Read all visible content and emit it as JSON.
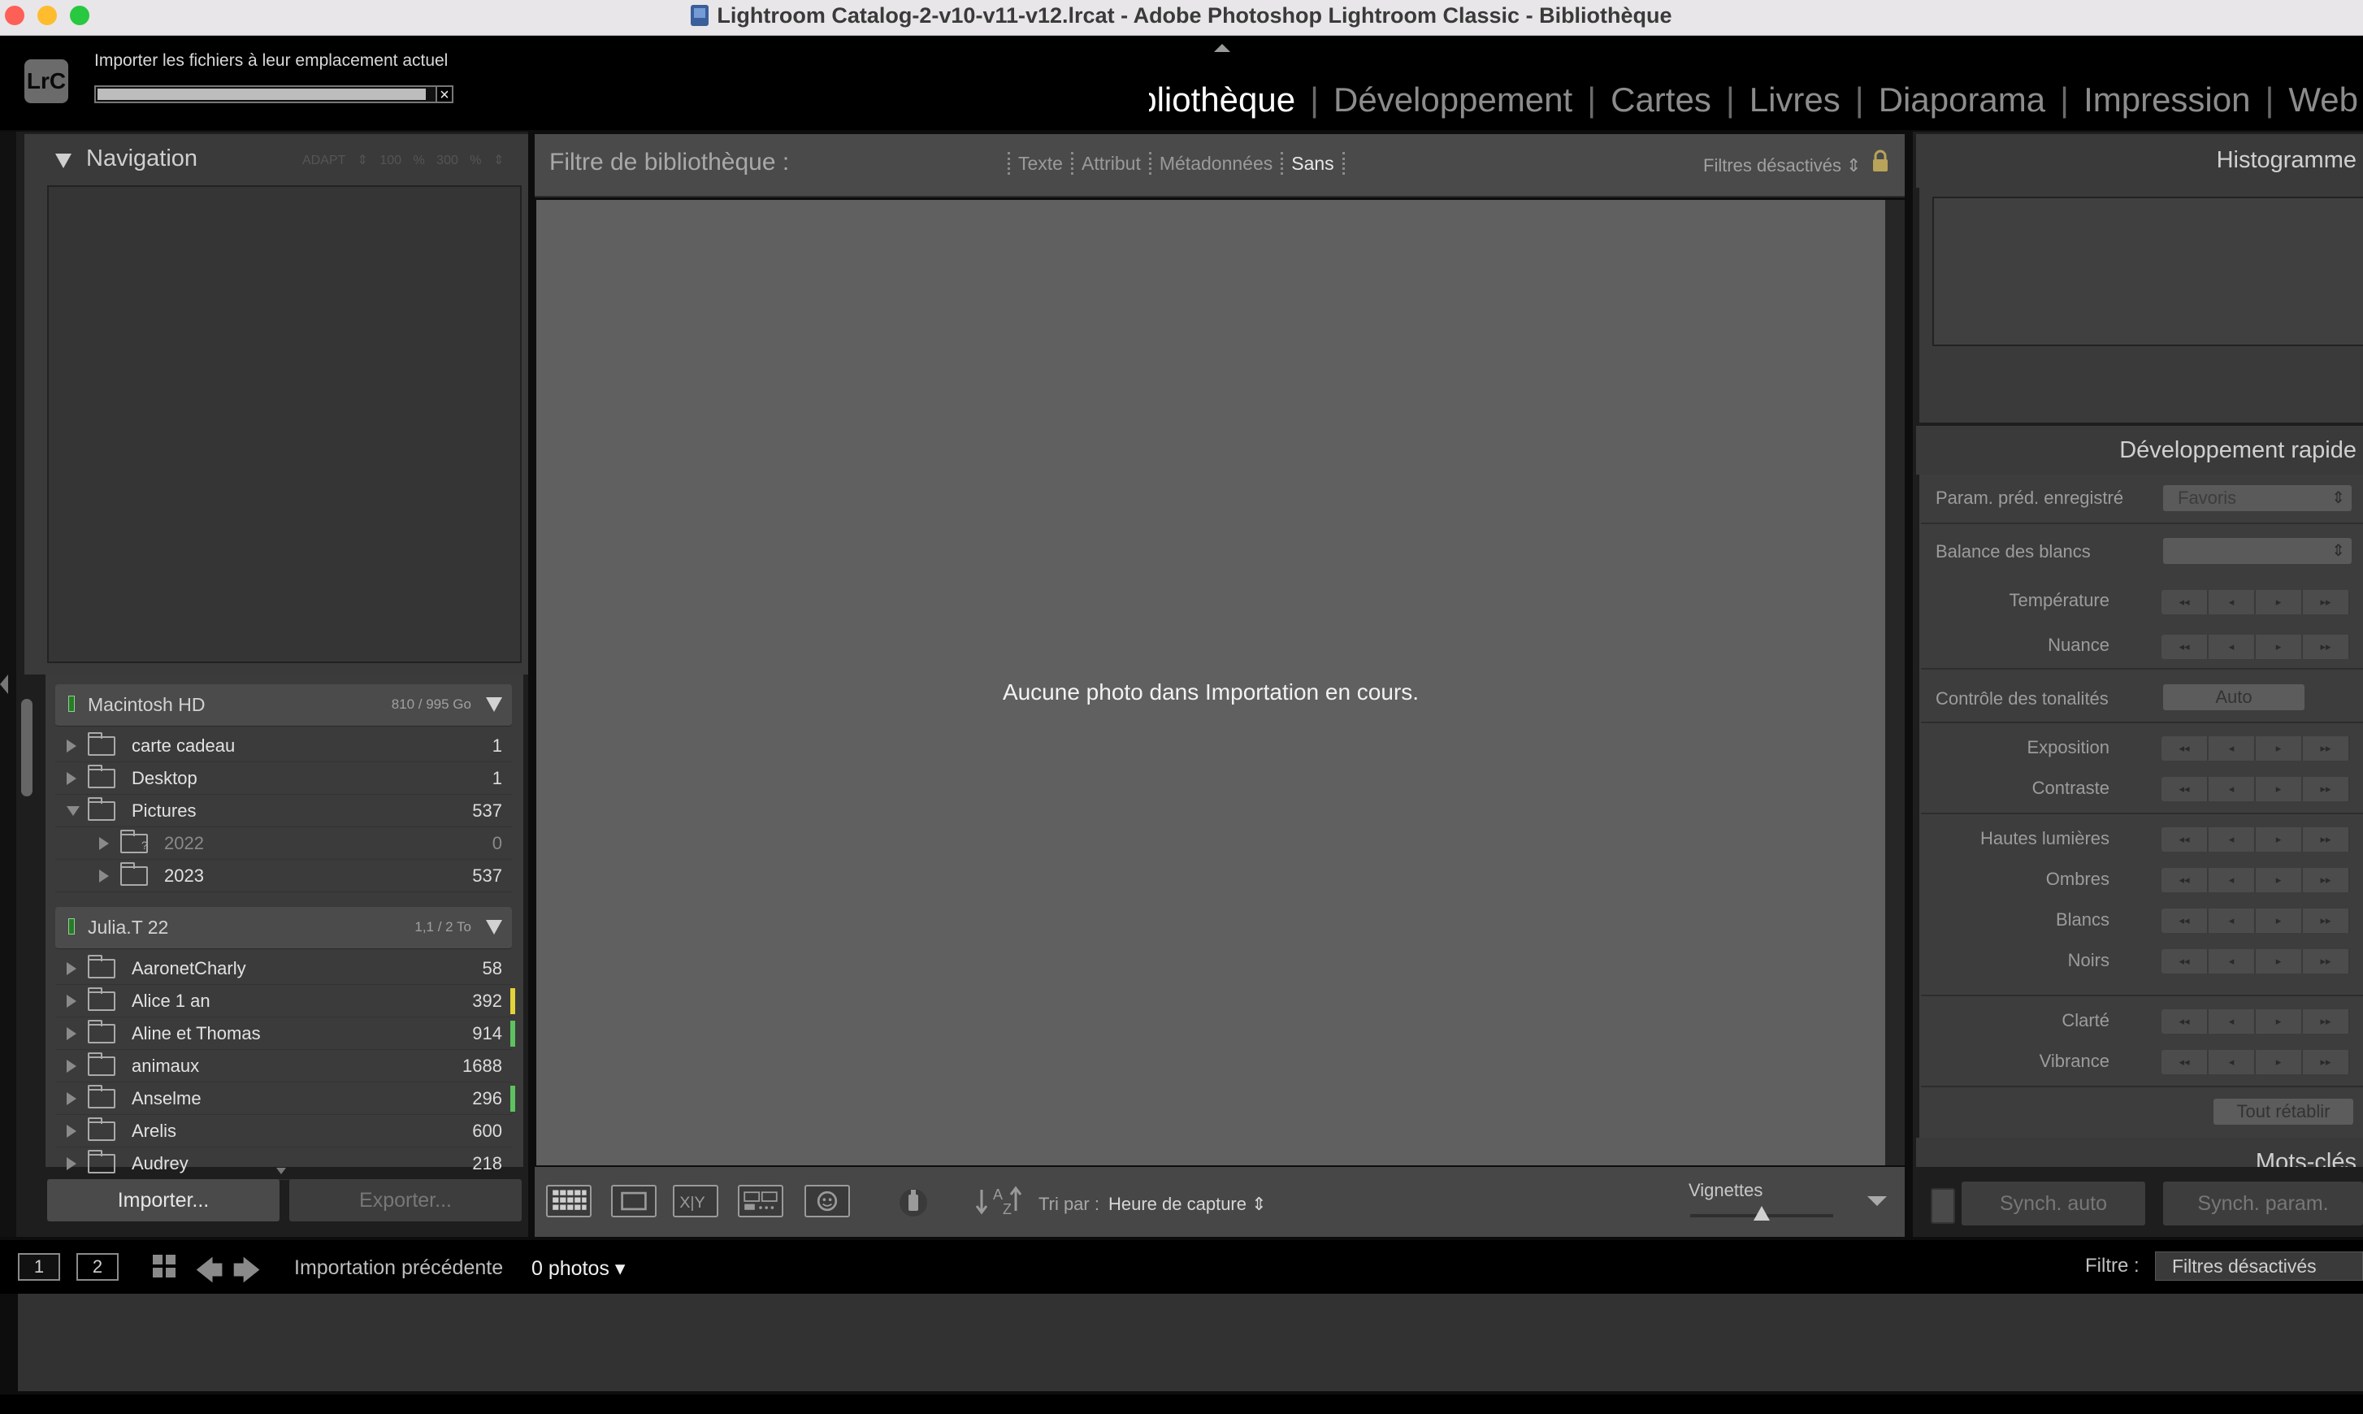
{
  "window": {
    "title": "Lightroom Catalog-2-v10-v11-v12.lrcat - Adobe Photoshop Lightroom Classic - Bibliothèque"
  },
  "identity": {
    "logo": "LrC",
    "import_status": "Importer les fichiers à leur emplacement actuel",
    "import_progress_percent": 97,
    "modules": [
      "ibliothèque",
      "Développement",
      "Cartes",
      "Livres",
      "Diaporama",
      "Impression",
      "Web"
    ],
    "active_module": "ibliothèque"
  },
  "navigator": {
    "title": "Navigation",
    "options": "ADAPT ⇕   100 %   300 % ⇕"
  },
  "folders": {
    "volumes": [
      {
        "name": "Macintosh HD",
        "size": "810 / 995 Go",
        "items": [
          {
            "name": "carte cadeau",
            "count": "1",
            "level": 0,
            "expanded": false
          },
          {
            "name": "Desktop",
            "count": "1",
            "level": 0,
            "expanded": false
          },
          {
            "name": "Pictures",
            "count": "537",
            "level": 0,
            "expanded": true
          },
          {
            "name": "2022",
            "count": "0",
            "level": 1,
            "expanded": false,
            "missing": true
          },
          {
            "name": "2023",
            "count": "537",
            "level": 1,
            "expanded": false
          }
        ]
      },
      {
        "name": "Julia.T 22",
        "size": "1,1 / 2 To",
        "items": [
          {
            "name": "AaronetCharly",
            "count": "58",
            "level": 0
          },
          {
            "name": "Alice 1 an",
            "count": "392",
            "level": 0,
            "label_color": "#e3d23a"
          },
          {
            "name": "Aline et Thomas",
            "count": "914",
            "level": 0,
            "label_color": "#5ec25e"
          },
          {
            "name": "animaux",
            "count": "1688",
            "level": 0
          },
          {
            "name": "Anselme",
            "count": "296",
            "level": 0,
            "label_color": "#5ec25e"
          },
          {
            "name": "Arelis",
            "count": "600",
            "level": 0
          },
          {
            "name": "Audrey",
            "count": "218",
            "level": 0
          }
        ]
      }
    ]
  },
  "left_buttons": {
    "import": "Importer...",
    "export": "Exporter..."
  },
  "filter_bar": {
    "label": "Filtre de bibliothèque :",
    "tabs": [
      "Texte",
      "Attribut",
      "Métadonnées",
      "Sans"
    ],
    "active_tab": "Sans",
    "preset": "Filtres désactivés ⇕"
  },
  "content": {
    "empty_message": "Aucune photo dans Importation en cours."
  },
  "toolbar": {
    "sort_label": "Tri par :",
    "sort_value": "Heure de capture ⇕",
    "thumbnails_label": "Vignettes",
    "thumbnail_size_fraction": 0.5
  },
  "histogram": {
    "title": "Histogramme"
  },
  "quick_develop": {
    "title": "Développement rapide",
    "saved_preset_label": "Param. préd. enregistré",
    "saved_preset_value": "Favoris",
    "white_balance_label": "Balance des blancs",
    "white_balance_value": "",
    "temperature": "Température",
    "tint": "Nuance",
    "tone_control": "Contrôle des tonalités",
    "auto": "Auto",
    "exposure": "Exposition",
    "contrast": "Contraste",
    "highlights": "Hautes lumières",
    "shadows": "Ombres",
    "whites": "Blancs",
    "blacks": "Noirs",
    "clarity": "Clarté",
    "vibrance": "Vibrance",
    "reset_all": "Tout rétablir",
    "step_glyphs": [
      "◂◂",
      "◂",
      "▸",
      "▸▸"
    ]
  },
  "keywords": {
    "title": "Mots-clés"
  },
  "sync": {
    "auto": "Synch. auto",
    "params": "Synch. param."
  },
  "filmstrip": {
    "screen1": "1",
    "screen2": "2",
    "source": "Importation précédente",
    "count": "0 photos ▾",
    "filter_label": "Filtre :",
    "filter_value": "Filtres désactivés"
  }
}
